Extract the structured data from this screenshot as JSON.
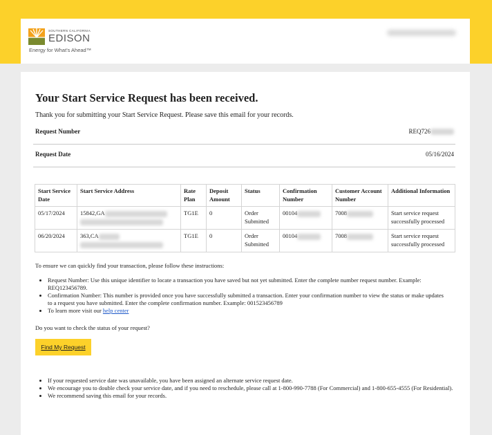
{
  "brand": {
    "small": "SOUTHERN CALIFORNIA",
    "name": "EDISON",
    "tagline": "Energy for What's Ahead™",
    "colors": {
      "yellow": "#fcd12a",
      "logo_green": "#7a8a2e",
      "logo_orange": "#f3a21c"
    }
  },
  "email": {
    "title": "Your Start Service Request has been received.",
    "thanks": "Thank you for submitting your Start Service Request. Please save this email for your records.",
    "request_number_label": "Request Number",
    "request_number_value": "REQ726",
    "request_date_label": "Request Date",
    "request_date_value": "05/16/2024"
  },
  "table": {
    "headers": [
      "Start Service Date",
      "Start Service Address",
      "Rate Plan",
      "Deposit Amount",
      "Status",
      "Confirmation Number",
      "Customer Account Number",
      "Additional Information"
    ],
    "rows": [
      [
        "05/17/2024",
        "15842,GA",
        "TG1E",
        "0",
        "Order Submitted",
        "00104",
        "7008",
        "Start service request successfully processed"
      ],
      [
        "06/20/2024",
        "363,CA",
        "TG1E",
        "0",
        "Order Submitted",
        "00104",
        "7008",
        "Start service request successfully processed"
      ]
    ]
  },
  "instructions": {
    "intro": "To ensure we can quickly find your transaction, please follow these instructions:",
    "item1": "Request Number: Use this unique identifier to locate a transaction you have saved but not yet submitted. Enter the complete number request number. Example: REQ123456789.",
    "item2": "Confirmation Number: This number is provided once you have successfully submitted a transaction. Enter your confirmation number to view the status or make updates to a request you have submitted. Enter the complete confirmation number. Example: 001523456789",
    "item3_prefix": "To learn more visit our ",
    "item3_link": "help center"
  },
  "check_status": {
    "question": "Do you want to check the status of your request?",
    "button": "Find My Request"
  },
  "notes": [
    "If your requested service date was unavailable, you have been assigned an alternate service request date.",
    "We encourage you to double check your service date, and if you need to reschedule, please call at 1-800-990-7788 (For Commercial) and 1-800-655-4555 (For Residential).",
    "We recommend saving this email for your records."
  ]
}
